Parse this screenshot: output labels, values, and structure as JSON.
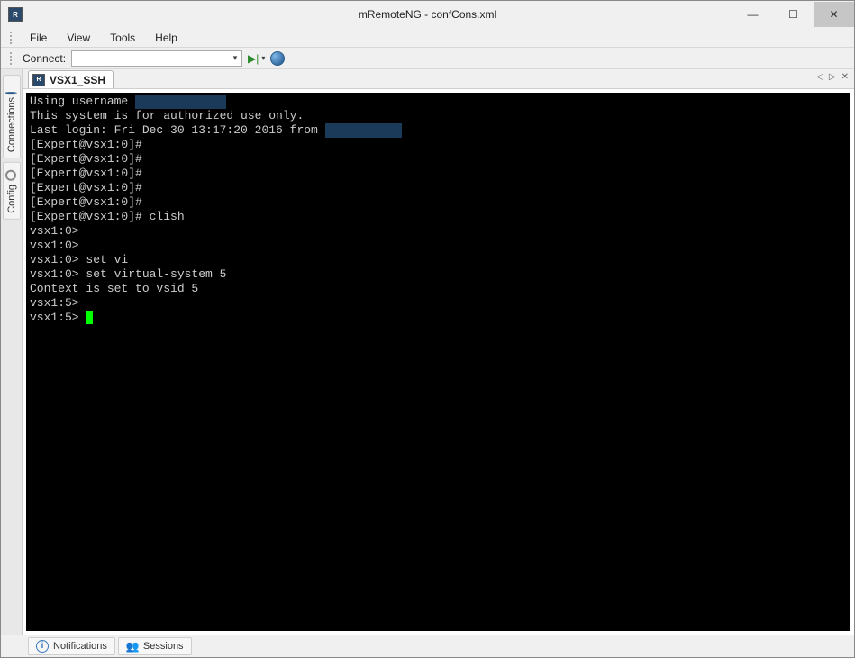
{
  "window": {
    "title": "mRemoteNG - confCons.xml",
    "app_icon_text": "R"
  },
  "menu": {
    "items": [
      "File",
      "View",
      "Tools",
      "Help"
    ]
  },
  "connectbar": {
    "label": "Connect:"
  },
  "sidebar": {
    "tabs": [
      {
        "label": "Connections"
      },
      {
        "label": "Config"
      }
    ]
  },
  "tabs": {
    "active": {
      "label": "VSX1_SSH",
      "icon_text": "R"
    }
  },
  "terminal": {
    "lines": [
      {
        "segments": [
          {
            "t": "Using username "
          },
          {
            "t": "             ",
            "redact": true
          }
        ]
      },
      {
        "segments": [
          {
            "t": "This system is for authorized use only."
          }
        ]
      },
      {
        "segments": [
          {
            "t": "Last login: Fri Dec 30 13:17:20 2016 from "
          },
          {
            "t": "           ",
            "redact": true
          }
        ]
      },
      {
        "segments": [
          {
            "t": "[Expert@vsx1:0]#"
          }
        ]
      },
      {
        "segments": [
          {
            "t": "[Expert@vsx1:0]#"
          }
        ]
      },
      {
        "segments": [
          {
            "t": "[Expert@vsx1:0]#"
          }
        ]
      },
      {
        "segments": [
          {
            "t": "[Expert@vsx1:0]#"
          }
        ]
      },
      {
        "segments": [
          {
            "t": "[Expert@vsx1:0]#"
          }
        ]
      },
      {
        "segments": [
          {
            "t": "[Expert@vsx1:0]# clish"
          }
        ]
      },
      {
        "segments": [
          {
            "t": "vsx1:0>"
          }
        ]
      },
      {
        "segments": [
          {
            "t": "vsx1:0>"
          }
        ]
      },
      {
        "segments": [
          {
            "t": "vsx1:0> set vi"
          }
        ]
      },
      {
        "segments": [
          {
            "t": "vsx1:0> set virtual-system 5"
          }
        ]
      },
      {
        "segments": [
          {
            "t": "Context is set to vsid 5"
          }
        ]
      },
      {
        "segments": [
          {
            "t": "vsx1:5>"
          }
        ]
      },
      {
        "segments": [
          {
            "t": "vsx1:5> "
          },
          {
            "cursor": true
          }
        ]
      }
    ]
  },
  "bottom": {
    "tabs": [
      {
        "label": "Notifications"
      },
      {
        "label": "Sessions"
      }
    ]
  }
}
